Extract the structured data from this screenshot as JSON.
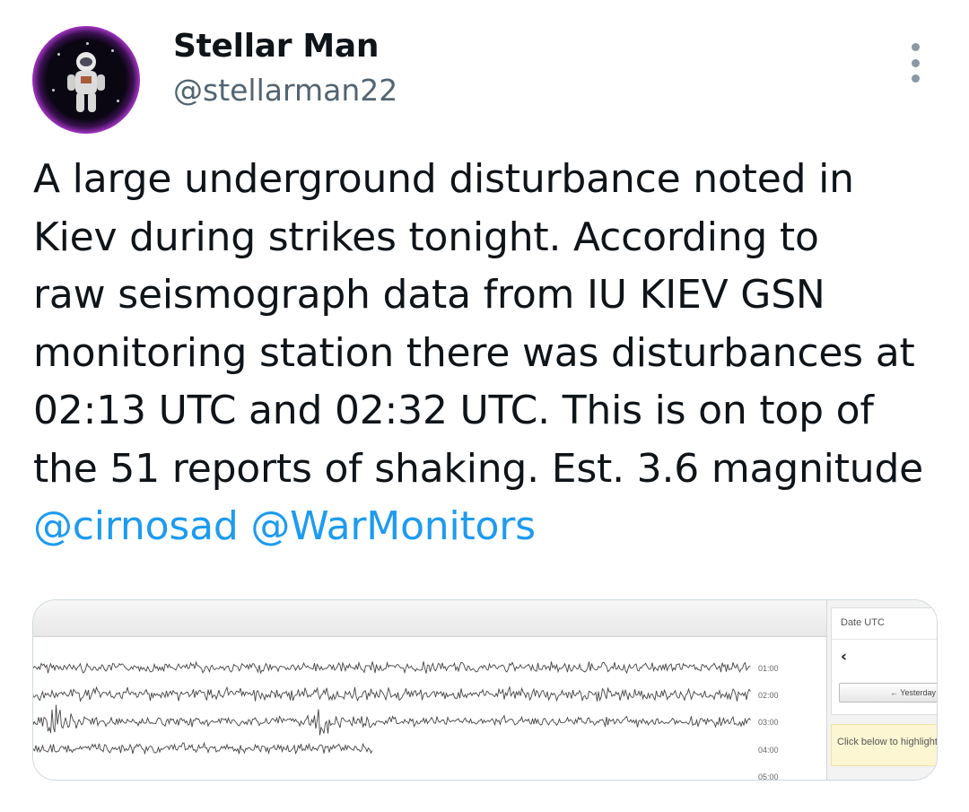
{
  "user": {
    "display_name": "Stellar Man",
    "handle": "@stellarman22",
    "avatar_icon": "astronaut-avatar"
  },
  "menu": {
    "icon": "more-vertical-icon"
  },
  "tweet": {
    "lines": [
      "A large underground disturbance noted in",
      "Kiev during strikes tonight. According to",
      "raw seismograph data from IU KIEV GSN",
      "monitoring station there was disturbances at",
      "02:13 UTC and 02:32 UTC. This is on top of",
      "the 51 reports of shaking. Est. 3.6 magnitude"
    ],
    "mentions": [
      "@cirnosad",
      "@WarMonitors"
    ]
  },
  "media": {
    "time_ticks": [
      "01:00",
      "02:00",
      "03:00",
      "04:00",
      "05:00"
    ],
    "side_panel": {
      "date_label": "Date UTC",
      "prev_icon": "chevron-left-icon",
      "yesterday_label": "← Yesterday",
      "highlight_text": "Click below to highlight"
    }
  },
  "colors": {
    "accent": "#1d9bf0",
    "secondary_text": "#536471",
    "avatar_ring": "#b53ad8"
  }
}
